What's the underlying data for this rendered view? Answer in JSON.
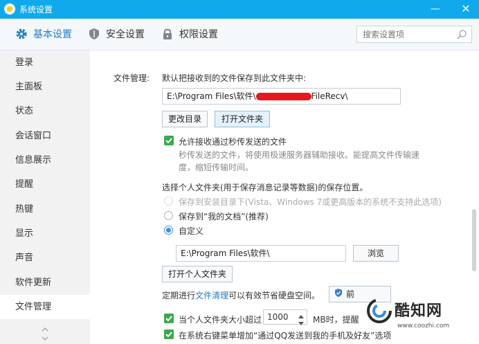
{
  "window": {
    "title": "系统设置",
    "min_label": "—",
    "close_label": "✕"
  },
  "tabs": [
    {
      "label": "基本设置",
      "icon": "gear-icon",
      "active": true
    },
    {
      "label": "安全设置",
      "icon": "shield-icon",
      "active": false
    },
    {
      "label": "权限设置",
      "icon": "lock-icon",
      "active": false
    }
  ],
  "search": {
    "placeholder": "搜索设置项"
  },
  "sidebar": {
    "items": [
      {
        "label": "登录"
      },
      {
        "label": "主面板"
      },
      {
        "label": "状态"
      },
      {
        "label": "会话窗口"
      },
      {
        "label": "信息展示"
      },
      {
        "label": "提醒"
      },
      {
        "label": "热键"
      },
      {
        "label": "显示"
      },
      {
        "label": "声音"
      },
      {
        "label": "软件更新"
      },
      {
        "label": "文件管理",
        "active": true
      }
    ]
  },
  "file_mgmt": {
    "section_label": "文件管理:",
    "save_path_desc": "默认把接收到的文件保存到此文件夹中:",
    "save_path_prefix": "E:\\Program Files\\软件\\",
    "save_path_suffix": "FileRecv\\",
    "change_dir_button": "更改目录",
    "open_folder_button": "打开文件夹",
    "allow_fast_transfer": {
      "label": "允许接收通过秒传发送的文件",
      "checked": true,
      "desc_line1": "秒传发送的文件，将使用极速服务器辅助接收。能提高文件传输速",
      "desc_line2": "度，缩短传输时间。"
    },
    "personal_folder_desc": "选择个人文件夹(用于保存消息记录等数据)的保存位置。",
    "radio_options": [
      {
        "label": "保存到安装目录下(Vista、Windows 7或更高版本的系统不支持此选项)",
        "state": "disabled"
      },
      {
        "label": "保存到“我的文档”(推荐)",
        "state": "off"
      },
      {
        "label": "自定义",
        "state": "on"
      }
    ],
    "custom_path": "E:\\Program Files\\软件\\",
    "browse_button": "浏览",
    "open_personal_button": "打开个人文件夹",
    "cleanup_prefix": "定期进行",
    "cleanup_link": "文件清理",
    "cleanup_suffix": "可以有效节省硬盘空间。",
    "cleanup_button": "前",
    "size_limit": {
      "label": "当个人文件夹大小超过",
      "value": "1000",
      "unit_text": "MB时，提醒",
      "checked": true
    },
    "context_menu": {
      "label": "在系统右键菜单增加“通过QQ发送到我的手机及好友”选项",
      "checked": true
    }
  },
  "watermark": {
    "brand": "酷知网",
    "url": "www.coozhi.com"
  }
}
